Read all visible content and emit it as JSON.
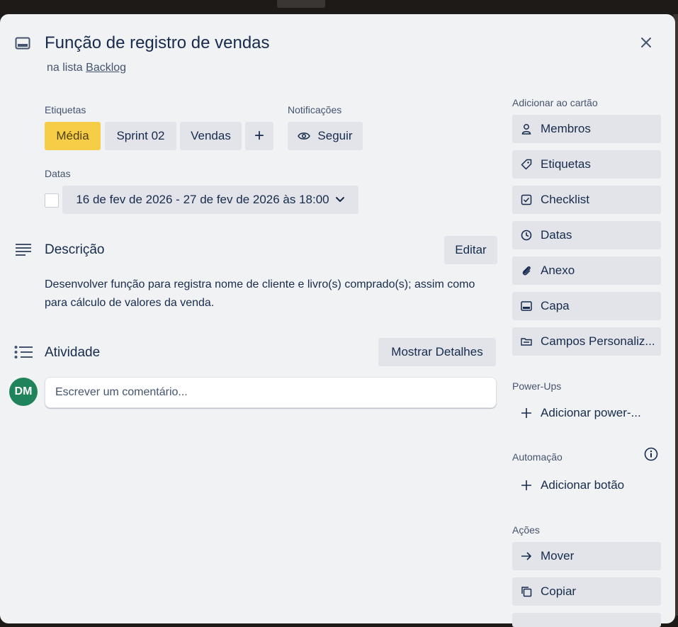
{
  "card": {
    "title": "Função de registro de vendas",
    "list_prefix": "na lista",
    "list_name": "Backlog"
  },
  "labels_section": {
    "heading": "Etiquetas",
    "items": [
      "Média",
      "Sprint 02",
      "Vendas"
    ],
    "add_symbol": "+"
  },
  "notifications": {
    "heading": "Notificações",
    "follow_label": "Seguir"
  },
  "dates": {
    "heading": "Datas",
    "range": "16 de fev de 2026 - 27 de fev de 2026 às 18:00"
  },
  "description": {
    "heading": "Descrição",
    "edit_label": "Editar",
    "text": "Desenvolver função para registra nome de cliente e livro(s) comprado(s); assim como para cálculo de valores da venda."
  },
  "activity": {
    "heading": "Atividade",
    "details_label": "Mostrar Detalhes",
    "avatar_initials": "DM",
    "comment_placeholder": "Escrever um comentário..."
  },
  "sidebar": {
    "add_heading": "Adicionar ao cartão",
    "add_items": [
      "Membros",
      "Etiquetas",
      "Checklist",
      "Datas",
      "Anexo",
      "Capa",
      "Campos Personaliz..."
    ],
    "powerups_heading": "Power-Ups",
    "powerups_add": "Adicionar power-...",
    "automation_heading": "Automação",
    "automation_add": "Adicionar botão",
    "actions_heading": "Ações",
    "action_items": [
      "Mover",
      "Copiar"
    ]
  },
  "colors": {
    "label_media": "#f5cd47",
    "avatar": "#1f845a",
    "modal_bg": "#f1f2f4",
    "button_bg": "#e2e4e9"
  }
}
